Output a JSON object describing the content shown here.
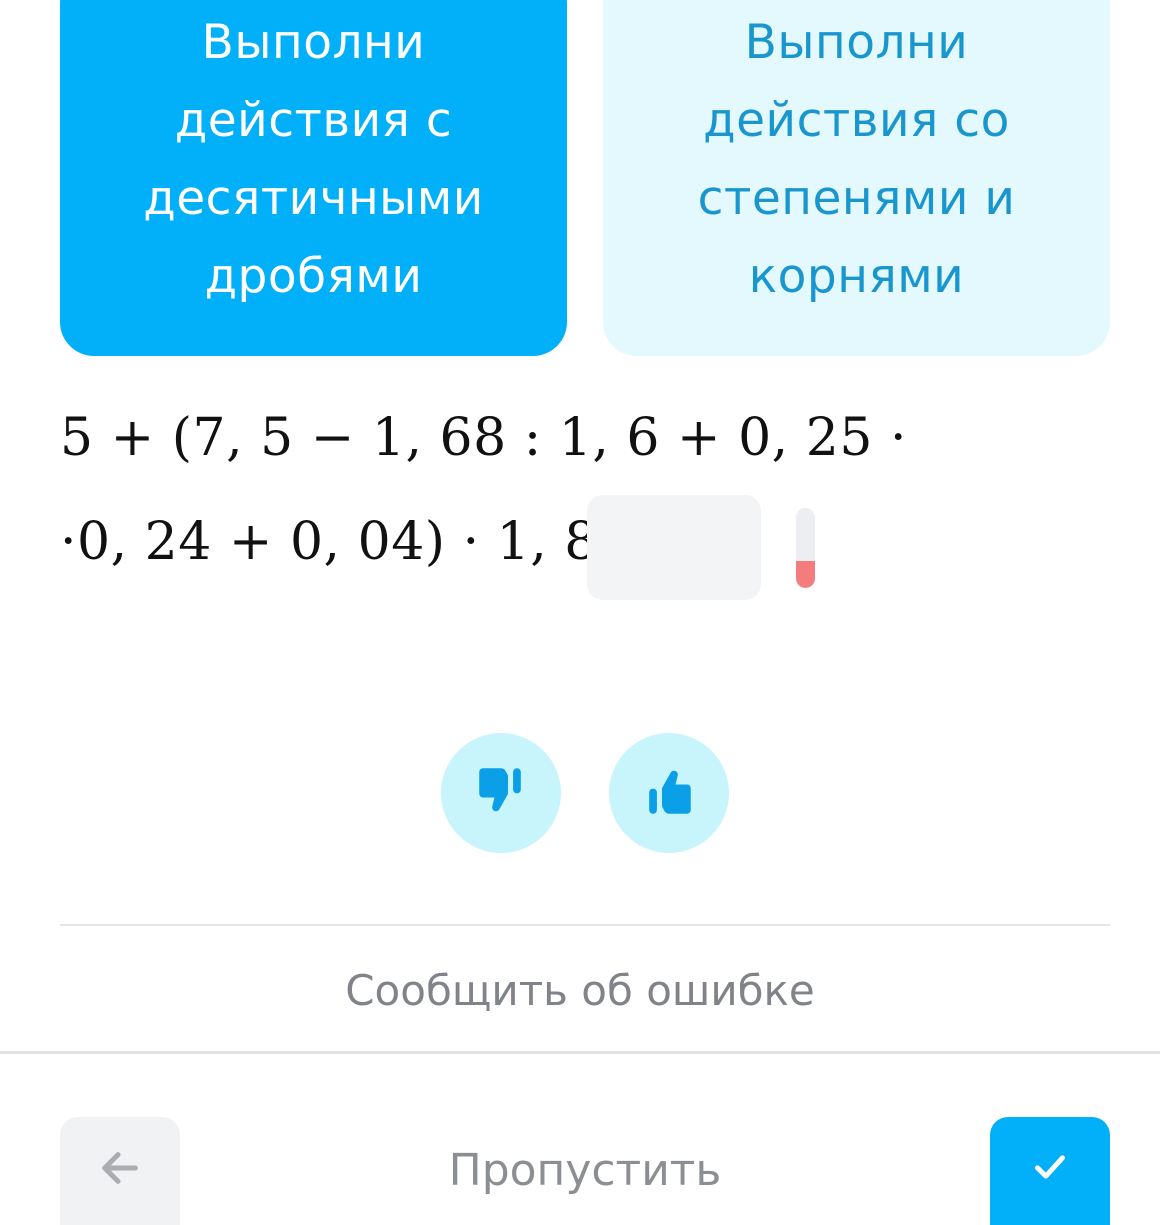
{
  "topics": {
    "active": {
      "label": "Выполни\nдействия с\nдесятичными\nдробями"
    },
    "inactive": {
      "label": "Выполни\nдействия со\nстепенями и\nкорнями"
    }
  },
  "problem": {
    "line1": "5 + (7, 5 − 1, 68 : 1, 6 + 0, 25 ·",
    "line2": "·0, 24 + 0, 04) · 1, 8 =",
    "answer_value": "",
    "answer_placeholder": "",
    "level_fraction": 0.34
  },
  "feedback": {
    "dislike_icon": "thumbs-down-icon",
    "like_icon": "thumbs-up-icon",
    "icon_color": "#0a9fe6"
  },
  "report_error_label": "Сообщить об ошибке",
  "bottom_bar": {
    "back_icon": "arrow-left-icon",
    "skip_label": "Пропустить",
    "submit_icon": "checkmark-icon"
  },
  "colors": {
    "accent": "#01b0f9",
    "accent_light": "#e3f9fd",
    "feedback_bg": "#c8f4fc",
    "level_fill": "#f47c7c"
  }
}
